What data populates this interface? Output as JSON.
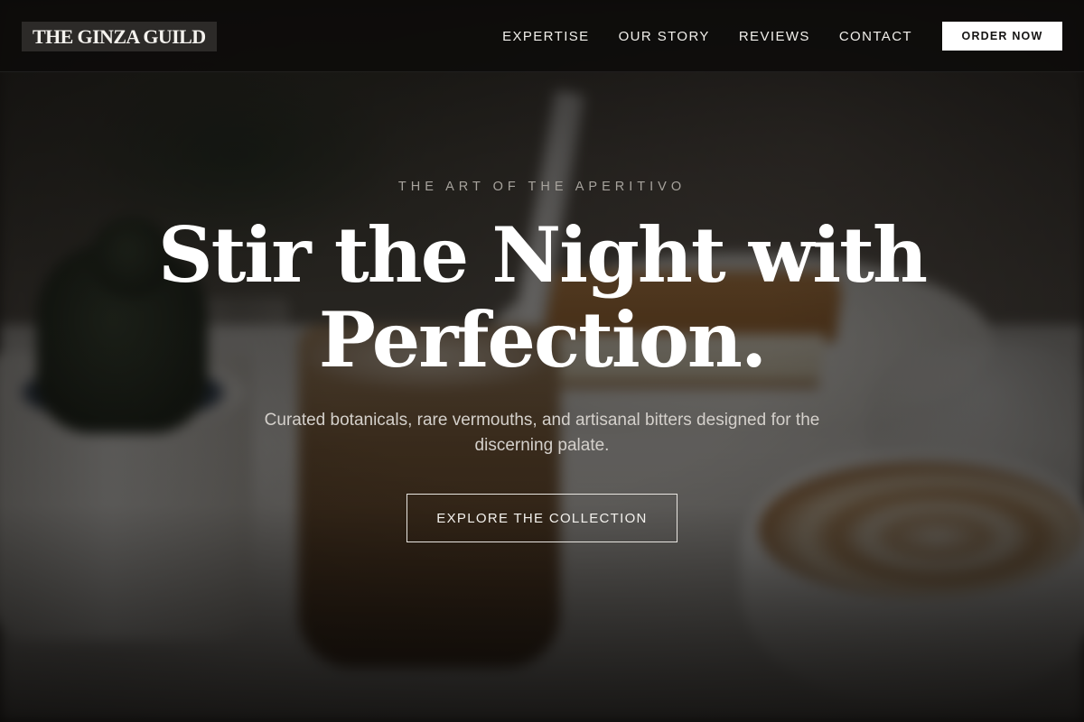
{
  "nav": {
    "brand": "THE GINZA GUILD",
    "links": [
      "EXPERTISE",
      "OUR STORY",
      "REVIEWS",
      "CONTACT"
    ],
    "cta": "ORDER NOW"
  },
  "hero": {
    "eyebrow": "THE ART OF THE APERITIVO",
    "headline": "Stir the Night with Perfection.",
    "subtitle": "Curated botanicals, rare vermouths, and artisanal bitters designed for the discerning palate.",
    "cta": "EXPLORE THE COLLECTION"
  },
  "colors": {
    "nav_background": "#0c0b0a",
    "overlay": "#0a0908",
    "text_primary": "#ffffff",
    "button_background": "#ffffff",
    "button_text": "#151413"
  }
}
